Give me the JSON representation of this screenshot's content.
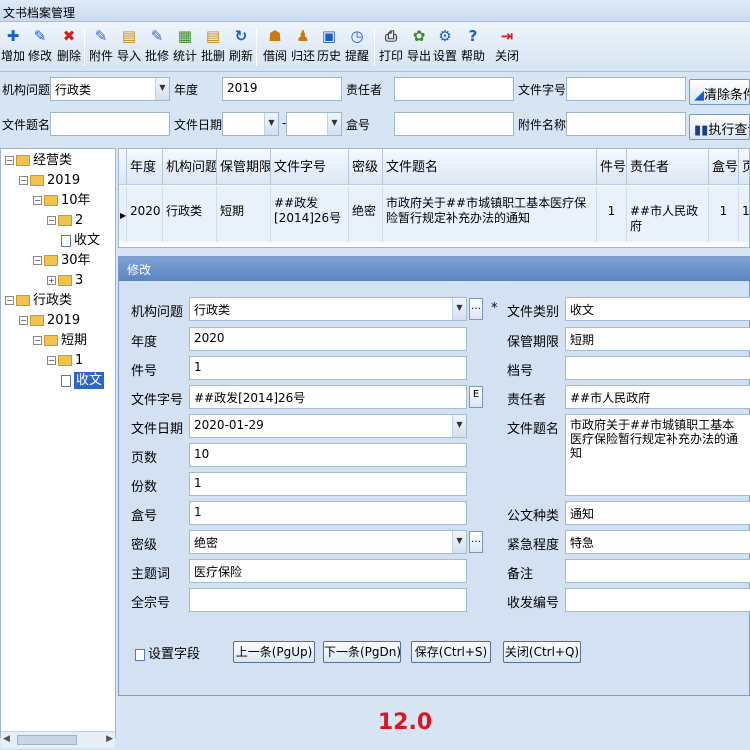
{
  "window": {
    "title": "文书档案管理"
  },
  "toolbar": [
    {
      "label": "增加",
      "icon": "plus-icon",
      "glyph": "✚",
      "color": "#1a5fc8"
    },
    {
      "label": "修改",
      "icon": "pencil-icon",
      "glyph": "✎",
      "color": "#1a5fc8"
    },
    {
      "label": "删除",
      "icon": "delete-icon",
      "glyph": "✖",
      "color": "#d0201a"
    },
    {
      "label": "附件",
      "icon": "attachment-icon",
      "glyph": "✎",
      "color": "#2a6fd0"
    },
    {
      "label": "导入",
      "icon": "import-icon",
      "glyph": "▤",
      "color": "#c88a10"
    },
    {
      "label": "批修",
      "icon": "batch-edit-icon",
      "glyph": "✎",
      "color": "#2a6fd0"
    },
    {
      "label": "统计",
      "icon": "statistics-icon",
      "glyph": "▦",
      "color": "#3a8a2a"
    },
    {
      "label": "批删",
      "icon": "batch-delete-icon",
      "glyph": "▤",
      "color": "#c88a10"
    },
    {
      "label": "刷新",
      "icon": "refresh-icon",
      "glyph": "↻",
      "color": "#1a5fc8"
    },
    {
      "label": "借阅",
      "icon": "borrow-icon",
      "glyph": "☗",
      "color": "#c87a10"
    },
    {
      "label": "归还",
      "icon": "return-icon",
      "glyph": "♟",
      "color": "#c87a10"
    },
    {
      "label": "历史",
      "icon": "history-icon",
      "glyph": "▣",
      "color": "#1a5fc8"
    },
    {
      "label": "提醒",
      "icon": "alarm-icon",
      "glyph": "◷",
      "color": "#1a5fc8"
    },
    {
      "label": "打印",
      "icon": "printer-icon",
      "glyph": "⎙",
      "color": "#444444"
    },
    {
      "label": "导出",
      "icon": "export-icon",
      "glyph": "✿",
      "color": "#3a8a2a"
    },
    {
      "label": "设置",
      "icon": "settings-icon",
      "glyph": "⚙",
      "color": "#1a5fc8"
    },
    {
      "label": "帮助",
      "icon": "help-icon",
      "glyph": "?",
      "color": "#1a5fc8"
    },
    {
      "label": "关闭",
      "icon": "exit-icon",
      "glyph": "⇥",
      "color": "#d0201a"
    }
  ],
  "filters": {
    "org_label": "机构问题",
    "org_value": "行政类",
    "year_label": "年度",
    "year_value": "2019",
    "owner_label": "责任者",
    "owner_value": "",
    "docno_label": "文件字号",
    "docno_value": "",
    "clear_button": "清除条件",
    "title_label": "文件题名",
    "title_value": "",
    "date_label": "文件日期",
    "date_sep": "-",
    "box_label": "盒号",
    "box_value": "",
    "attach_label": "附件名称",
    "attach_value": "",
    "query_button": "执行查询"
  },
  "tree": [
    {
      "label": "经营类",
      "type": "folder",
      "level": 0,
      "expanded": true
    },
    {
      "label": "2019",
      "type": "folder",
      "level": 1,
      "expanded": true
    },
    {
      "label": "10年",
      "type": "folder",
      "level": 2,
      "expanded": true
    },
    {
      "label": "2",
      "type": "folder",
      "level": 3,
      "expanded": true
    },
    {
      "label": "收文",
      "type": "doc",
      "level": 4
    },
    {
      "label": "30年",
      "type": "folder",
      "level": 2,
      "expanded": true
    },
    {
      "label": "3",
      "type": "folder",
      "level": 3,
      "expanded": false
    },
    {
      "label": "行政类",
      "type": "folder",
      "level": 0,
      "expanded": true
    },
    {
      "label": "2019",
      "type": "folder",
      "level": 1,
      "expanded": true
    },
    {
      "label": "短期",
      "type": "folder",
      "level": 2,
      "expanded": true
    },
    {
      "label": "1",
      "type": "folder",
      "level": 3,
      "expanded": true
    },
    {
      "label": "收文",
      "type": "doc",
      "level": 4,
      "selected": true
    }
  ],
  "grid": {
    "columns": [
      "年度",
      "机构问题",
      "保管期限",
      "文件字号",
      "密级",
      "文件题名",
      "件号",
      "责任者",
      "盒号",
      "页"
    ],
    "rows": [
      [
        "2020",
        "行政类",
        "短期",
        "##政发[2014]26号",
        "绝密",
        "市政府关于##市城镇职工基本医疗保险暂行规定补充办法的通知",
        "1",
        "##市人民政府",
        "1",
        "1"
      ]
    ]
  },
  "dialog": {
    "title": "修改",
    "fields": {
      "org_label": "机构问题",
      "org_value": "行政类",
      "year_label": "年度",
      "year_value": "2020",
      "piece_label": "件号",
      "piece_value": "1",
      "docno_label": "文件字号",
      "docno_value": "##政发[2014]26号",
      "date_label": "文件日期",
      "date_value": "2020-01-29",
      "pages_label": "页数",
      "pages_value": "10",
      "copies_label": "份数",
      "copies_value": "1",
      "box_label": "盒号",
      "box_value": "1",
      "secret_label": "密级",
      "secret_value": "绝密",
      "subject_label": "主题词",
      "subject_value": "医疗保险",
      "fonds_label": "全宗号",
      "fonds_value": "",
      "required_mark": "*",
      "category_label": "文件类别",
      "category_value": "收文",
      "retention_label": "保管期限",
      "retention_value": "短期",
      "archive_label": "档号",
      "archive_value": "",
      "owner_label": "责任者",
      "owner_value": "##市人民政府",
      "doctitle_label": "文件题名",
      "doctitle_value": "市政府关于##市城镇职工基本医疗保险暂行规定补充办法的通知",
      "doctype_label": "公文种类",
      "doctype_value": "通知",
      "urgency_label": "紧急程度",
      "urgency_value": "特急",
      "remark_label": "备注",
      "remark_value": "",
      "sendno_label": "收发编号",
      "sendno_value": "",
      "docno_btn": "E",
      "ellipsis": "…"
    },
    "set_fields": "设置字段",
    "buttons": {
      "prev": "上一条(PgUp)",
      "next": "下一条(PgDn)",
      "save": "保存(Ctrl+S)",
      "close": "关闭(Ctrl+Q)"
    }
  },
  "badge": "12.0"
}
